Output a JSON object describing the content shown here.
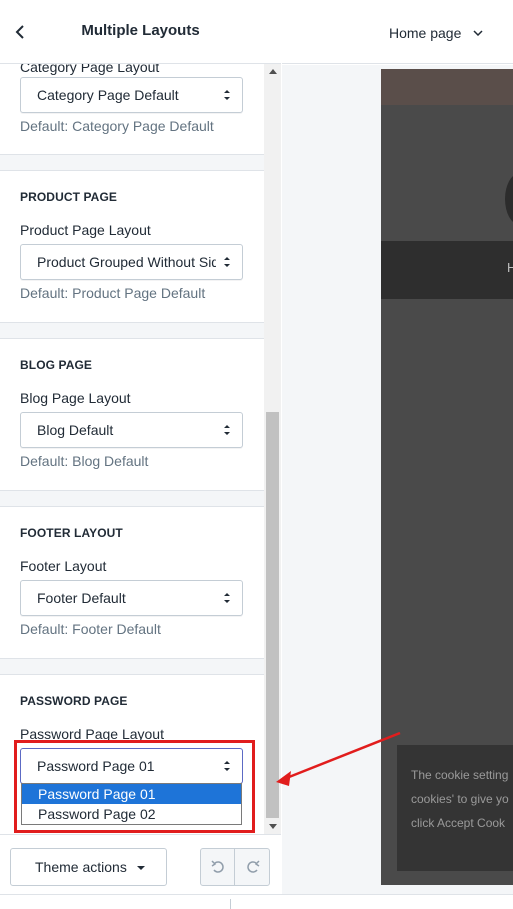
{
  "sidebar": {
    "title": "Multiple Layouts",
    "sections": [
      {
        "heading": "",
        "field_label": "Category Page Layout",
        "selected": "Category Page Default",
        "help": "Default: Category Page Default"
      },
      {
        "heading": "PRODUCT PAGE",
        "field_label": "Product Page Layout",
        "selected": "Product Grouped Without Sidebar",
        "help": "Default: Product Page Default"
      },
      {
        "heading": "BLOG PAGE",
        "field_label": "Blog Page Layout",
        "selected": "Blog Default",
        "help": "Default: Blog Default"
      },
      {
        "heading": "FOOTER LAYOUT",
        "field_label": "Footer Layout",
        "selected": "Footer Default",
        "help": "Default: Footer Default"
      },
      {
        "heading": "PASSWORD PAGE",
        "field_label": "Password Page Layout",
        "selected": "Password Page 01",
        "help": ""
      }
    ],
    "dropdown_options": [
      "Password Page 01",
      "Password Page 02"
    ],
    "footer": {
      "theme_actions_label": "Theme actions"
    }
  },
  "preview": {
    "page_selector": "Home page",
    "nav_item": "H",
    "cookie_lines": [
      "The cookie setting",
      "cookies' to give yo",
      "click Accept Cook"
    ]
  },
  "colors": {
    "highlight": "#e11d1d",
    "selected_option": "#1e74d8",
    "preview_bg": "#4a4a4a"
  },
  "icons": [
    "chevron-left-icon",
    "chevron-down-icon",
    "select-arrows-icon",
    "caret-down-icon",
    "undo-icon",
    "redo-icon",
    "arrow-icon"
  ]
}
